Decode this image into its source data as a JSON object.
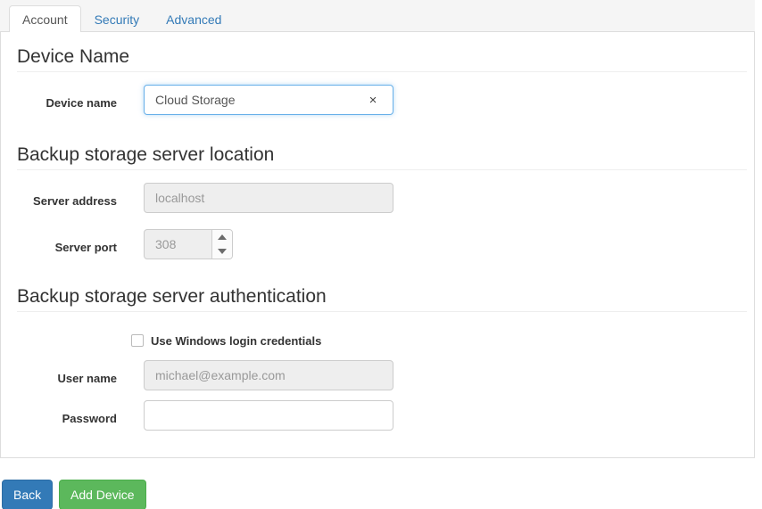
{
  "tabs": [
    {
      "label": "Account",
      "active": true
    },
    {
      "label": "Security",
      "active": false
    },
    {
      "label": "Advanced",
      "active": false
    }
  ],
  "sections": {
    "device": {
      "title": "Device Name",
      "device_name_label": "Device name",
      "device_name_value": "Cloud Storage",
      "clear_icon": "×"
    },
    "location": {
      "title": "Backup storage server location",
      "server_address_label": "Server address",
      "server_address_value": "localhost",
      "server_port_label": "Server port",
      "server_port_value": "308",
      "spinner_up_icon": "spinner-up-icon",
      "spinner_down_icon": "spinner-down-icon"
    },
    "auth": {
      "title": "Backup storage server authentication",
      "use_windows_label": "Use Windows login credentials",
      "use_windows_checked": false,
      "user_name_label": "User name",
      "user_name_value": "michael@example.com",
      "password_label": "Password",
      "password_value": ""
    }
  },
  "footer": {
    "back_label": "Back",
    "add_device_label": "Add Device"
  },
  "colors": {
    "link_blue": "#337ab7",
    "focus_blue": "#66afe9",
    "primary_button": "#337ab7",
    "success_button": "#5cb85c",
    "panel_border": "#dddddd",
    "tabbar_bg": "#f5f5f5",
    "disabled_bg": "#eeeeee"
  }
}
